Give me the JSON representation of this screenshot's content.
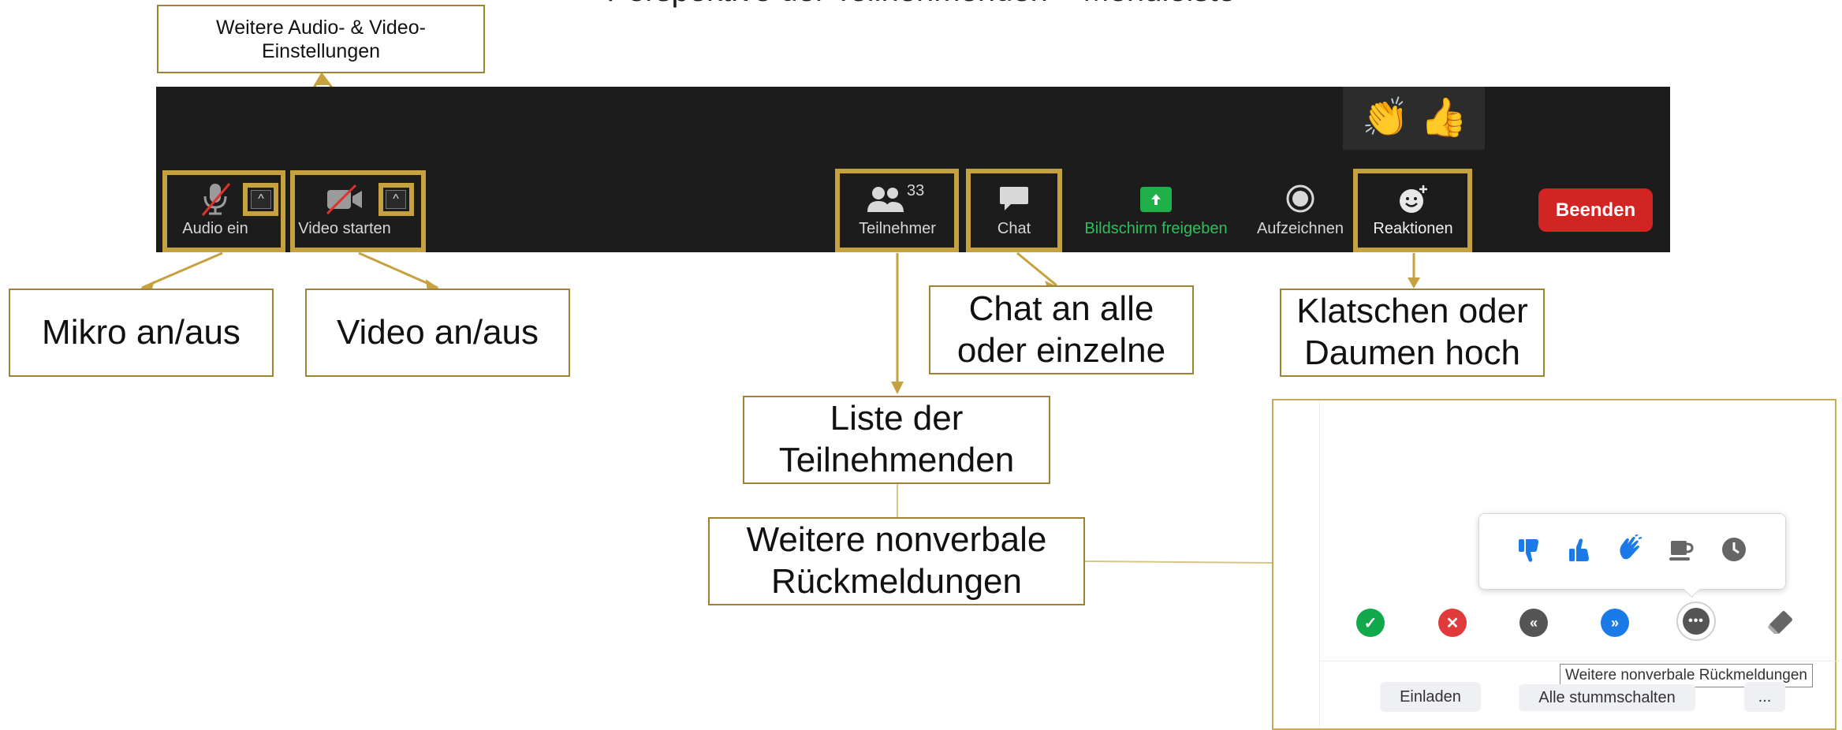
{
  "title": "Perspektive der Teilnehmenden – Menüleiste",
  "callouts": {
    "settings": "Weitere Audio- & Video-Einstellungen",
    "mic": "Mikro an/aus",
    "video": "Video an/aus",
    "chat": "Chat an alle oder einzelne",
    "reactions": "Klatschen oder Daumen hoch",
    "participants": "Liste der Teilnehmenden",
    "nonverbal": "Weitere nonverbale Rückmeldungen"
  },
  "toolbar": {
    "audio_label": "Audio ein",
    "video_label": "Video starten",
    "participants_label": "Teilnehmer",
    "participants_count": "33",
    "chat_label": "Chat",
    "share_label": "Bildschirm freigeben",
    "record_label": "Aufzeichnen",
    "reactions_label": "Reaktionen",
    "end_label": "Beenden",
    "caret_glyph": "^",
    "reaction_emojis": [
      "👏",
      "👍"
    ]
  },
  "panel": {
    "tooltip": "Weitere nonverbale Rückmeldungen",
    "invite_label": "Einladen",
    "mute_all_label": "Alle stummschalten",
    "more_label": "...",
    "feedback_icons": [
      "thumbs-down-icon",
      "thumbs-up-icon",
      "clap-icon",
      "coffee-icon",
      "clock-icon"
    ],
    "status_icons": [
      "yes-icon",
      "no-icon",
      "slower-icon",
      "faster-icon",
      "more-icon",
      "eraser-icon"
    ]
  },
  "colors": {
    "accent_border": "#c5a23f",
    "callout_border": "#a08236",
    "toolbar_bg": "#1c1c1c",
    "end_button": "#d32424",
    "share_green": "#1fb04a",
    "feedback_blue": "#1a7ae8"
  }
}
